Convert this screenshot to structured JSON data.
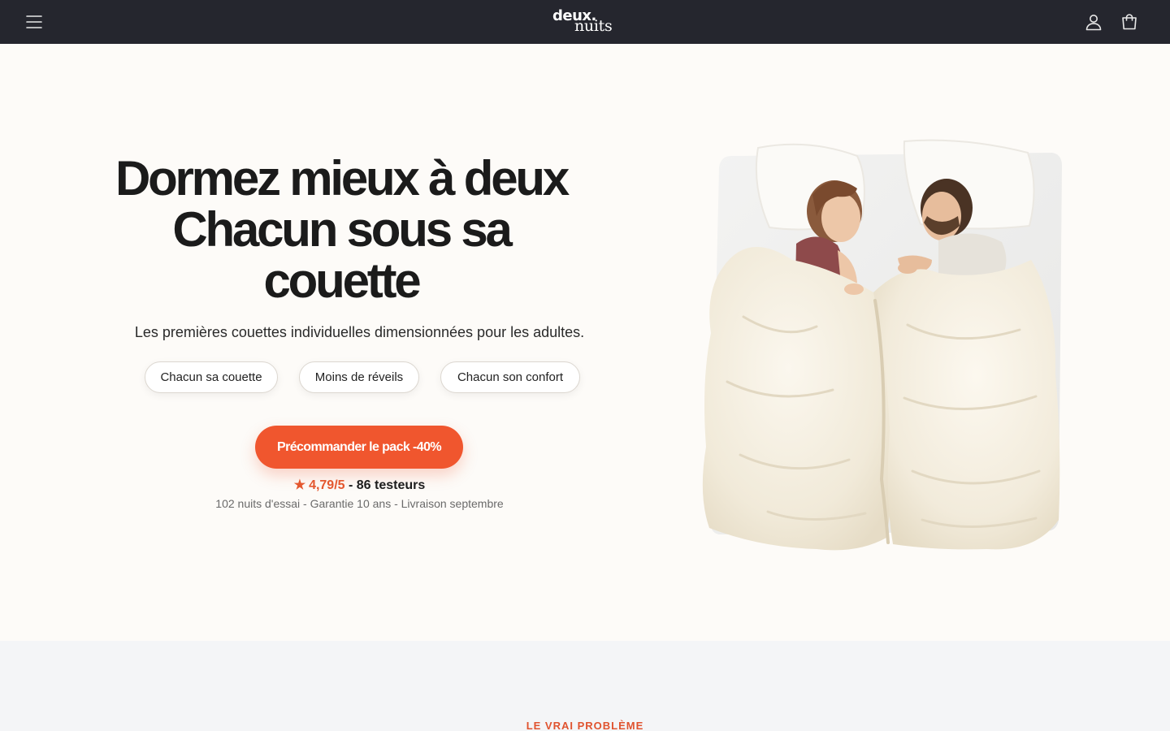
{
  "header": {
    "logo_line1": "deux.",
    "logo_line2": "nuits",
    "menu_icon": "hamburger-menu-icon",
    "account_icon": "user-icon",
    "cart_icon": "shopping-bag-icon",
    "background": "#25262e"
  },
  "hero": {
    "title_line1": "Dormez mieux à deux",
    "title_line2": "Chacun sous sa",
    "title_line3": "couette",
    "subtitle": "Les premières couettes individuelles dimensionnées pour les adultes.",
    "pills": [
      {
        "label": "Chacun sa couette"
      },
      {
        "label": "Moins de réveils"
      },
      {
        "label": "Chacun son confort"
      }
    ],
    "cta_label": "Précommander le pack -40%",
    "rating_icon": "star-icon",
    "rating_score": "4,79/5",
    "rating_sep": " - ",
    "rating_count": "86 testeurs",
    "meta": "102 nuits d'essai - Garantie 10 ans - Livraison septembre",
    "accent_color": "#f0562e"
  },
  "section2": {
    "eyebrow": "LE VRAI PROBLÈME"
  }
}
